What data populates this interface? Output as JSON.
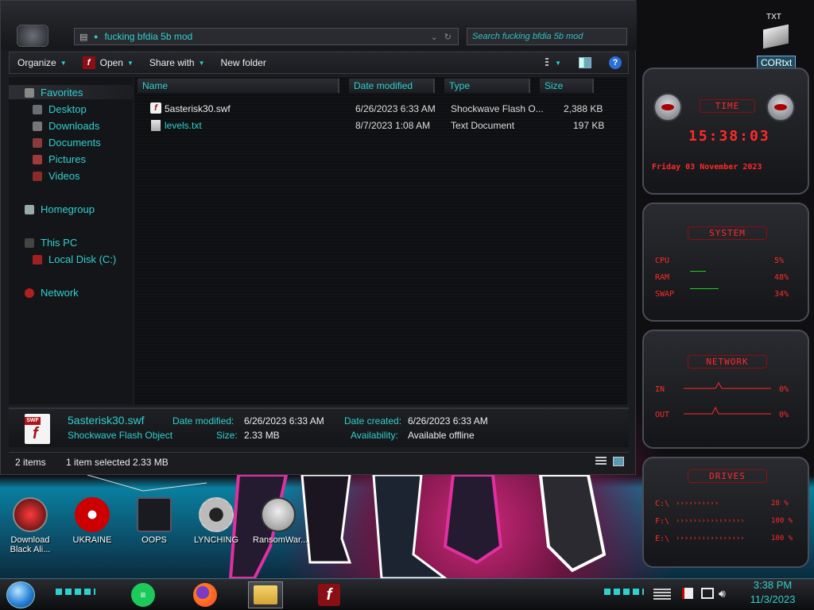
{
  "explorer": {
    "address": "fucking bfdia 5b mod",
    "search_placeholder": "Search fucking bfdia 5b mod",
    "toolbar": {
      "organize": "Organize",
      "open": "Open",
      "share_with": "Share with",
      "new_folder": "New folder"
    },
    "nav": {
      "favorites": "Favorites",
      "desktop": "Desktop",
      "downloads": "Downloads",
      "documents": "Documents",
      "pictures": "Pictures",
      "videos": "Videos",
      "homegroup": "Homegroup",
      "this_pc": "This PC",
      "local_disk": "Local Disk (C:)",
      "network": "Network"
    },
    "columns": {
      "name": "Name",
      "date_modified": "Date modified",
      "type": "Type",
      "size": "Size"
    },
    "files": [
      {
        "name": "5asterisk30.swf",
        "date": "6/26/2023 6:33 AM",
        "type": "Shockwave Flash O...",
        "size": "2,388 KB"
      },
      {
        "name": "levels.txt",
        "date": "8/7/2023 1:08 AM",
        "type": "Text Document",
        "size": "197 KB"
      }
    ],
    "details": {
      "file_name": "5asterisk30.swf",
      "file_type": "Shockwave Flash Object",
      "date_modified_label": "Date modified:",
      "date_modified": "6/26/2023 6:33 AM",
      "size_label": "Size:",
      "size": "2.33 MB",
      "date_created_label": "Date created:",
      "date_created": "6/26/2023 6:33 AM",
      "availability_label": "Availability:",
      "availability": "Available offline",
      "icon_badge": "SWF"
    },
    "status": {
      "items": "2 items",
      "selected": "1 item selected  2.33 MB"
    }
  },
  "desktop_file": {
    "tag": "TXT",
    "label": "CORtxt"
  },
  "gadgets": {
    "time": {
      "title": "TIME",
      "clock": "15:38:03",
      "date": "Friday 03 November 2023"
    },
    "system": {
      "title": "SYSTEM",
      "rows": [
        {
          "label": "CPU",
          "value": "5%"
        },
        {
          "label": "RAM",
          "value": "48%"
        },
        {
          "label": "SWAP",
          "value": "34%"
        }
      ]
    },
    "network": {
      "title": "NETWORK",
      "rows": [
        {
          "label": "IN",
          "value": "0%"
        },
        {
          "label": "OUT",
          "value": "0%"
        }
      ]
    },
    "drives": {
      "title": "DRIVES",
      "rows": [
        {
          "label": "C:\\",
          "value": "28 %"
        },
        {
          "label": "F:\\",
          "value": "100 %"
        },
        {
          "label": "E:\\",
          "value": "100 %"
        }
      ]
    }
  },
  "desktop_icons": [
    {
      "label": "Download Black Ali..."
    },
    {
      "label": "UKRAINE"
    },
    {
      "label": "OOPS"
    },
    {
      "label": "LYNCHING"
    },
    {
      "label": "RansomWar..."
    }
  ],
  "taskbar": {
    "time": "3:38 PM",
    "date": "11/3/2023"
  },
  "colors": {
    "accent": "#2fd0d0",
    "alert": "#ff2a2a",
    "window_bg": "#1b1c20"
  }
}
